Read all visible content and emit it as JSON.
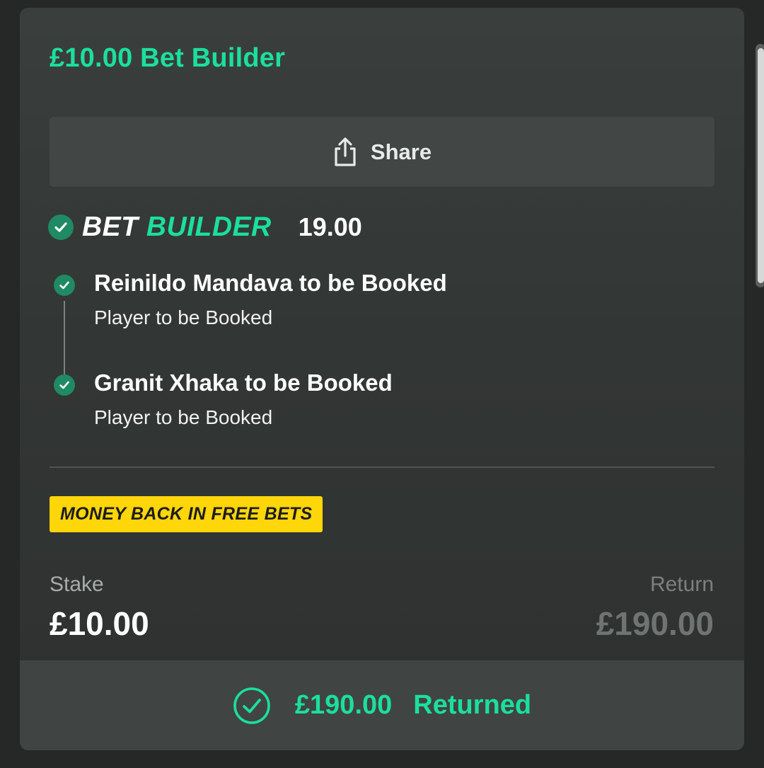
{
  "bet": {
    "title": "£10.00 Bet Builder",
    "share_label": "Share",
    "bet_builder_word1": "BET",
    "bet_builder_word2": "BUILDER",
    "odds": "19.00",
    "legs": [
      {
        "selection": "Reinildo Mandava to be Booked",
        "market": "Player to be Booked"
      },
      {
        "selection": "Granit Xhaka to be Booked",
        "market": "Player to be Booked"
      }
    ],
    "promo_badge": "MONEY BACK IN FREE BETS",
    "stake_label": "Stake",
    "stake_value": "£10.00",
    "return_label": "Return",
    "return_value": "£190.00",
    "result_amount": "£190.00",
    "result_status": "Returned"
  },
  "colors": {
    "accent": "#1bdf9d",
    "check_bg": "#1f8a63",
    "promo_bg": "#ffd60a"
  }
}
